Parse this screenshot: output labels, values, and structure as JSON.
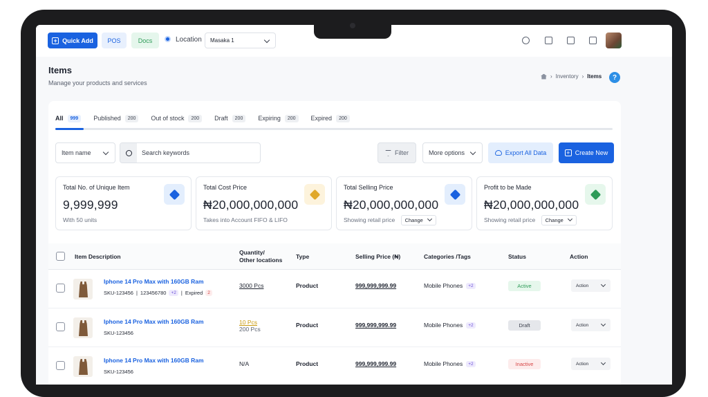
{
  "topbar": {
    "quick_add": "Quick Add",
    "pos": "POS",
    "docs": "Docs",
    "location_label": "Location",
    "location_value": "Masaka 1"
  },
  "header": {
    "title": "Items",
    "subtitle": "Manage your products and services",
    "breadcrumb": [
      "Inventory",
      "Items"
    ],
    "help": "?"
  },
  "tabs": [
    {
      "label": "All",
      "count": "999",
      "active": true
    },
    {
      "label": "Published",
      "count": "200"
    },
    {
      "label": "Out of stock",
      "count": "200"
    },
    {
      "label": "Draft",
      "count": "200"
    },
    {
      "label": "Expiring",
      "count": "200"
    },
    {
      "label": "Expired",
      "count": "200"
    }
  ],
  "filters": {
    "field_select": "Item name",
    "search_placeholder": "Search keywords",
    "filter": "Filter",
    "more_options": "More options",
    "export": "Export All Data",
    "create": "Create New"
  },
  "stats": [
    {
      "label": "Total No. of Unique Item",
      "value": "9,999,999",
      "note": "With 50 units",
      "icon": "cube-icon",
      "tint": "#e3eefd",
      "color": "#1a62e0"
    },
    {
      "label": "Total Cost Price",
      "value": "₦20,000,000,000",
      "note": "Takes into Account FIFO & LIFO",
      "icon": "tag-icon",
      "tint": "#fdf3dc",
      "color": "#e0a82a"
    },
    {
      "label": "Total Selling Price",
      "value": "₦20,000,000,000",
      "note": "Showing retail price",
      "change": "Change",
      "icon": "tag-icon",
      "tint": "#e3eefd",
      "color": "#1a62e0"
    },
    {
      "label": "Profit to be Made",
      "value": "₦20,000,000,000",
      "note": "Showing retail price",
      "change": "Change",
      "icon": "tag-icon",
      "tint": "#e6f7ec",
      "color": "#2e9b58"
    }
  ],
  "table": {
    "headers": {
      "item": "Item Description",
      "quantity_1": "Quantity/",
      "quantity_2": "Other locations",
      "type": "Type",
      "price": "Selling Price (₦)",
      "categories": "Categories /Tags",
      "status": "Status",
      "action": "Action"
    },
    "rows": [
      {
        "name": "Iphone 14 Pro Max with 160GB Ram",
        "sku": "SKU-123456",
        "extra": "123456780",
        "tag": "+2",
        "expired_label": "Expired",
        "expired_count": "2",
        "qty": "3000 Pcs",
        "qty2": "",
        "type": "Product",
        "price": "999,999,999.99",
        "category": "Mobile Phones",
        "cat_tag": "+2",
        "status": "Active",
        "action": "Action"
      },
      {
        "name": "Iphone 14 Pro Max with 160GB Ram",
        "sku": "SKU-123456",
        "qty": "10 Pcs",
        "qty2": "200 Pcs",
        "type": "Product",
        "price": "999,999,999.99",
        "category": "Mobile Phones",
        "cat_tag": "+2",
        "status": "Draft",
        "action": "Action"
      },
      {
        "name": "Iphone 14 Pro Max with 160GB Ram",
        "sku": "SKU-123456",
        "qty": "N/A",
        "qty2": "",
        "type": "Product",
        "price": "999,999,999.99",
        "category": "Mobile Phones",
        "cat_tag": "+2",
        "status": "Inactive",
        "action": "Action"
      }
    ]
  }
}
